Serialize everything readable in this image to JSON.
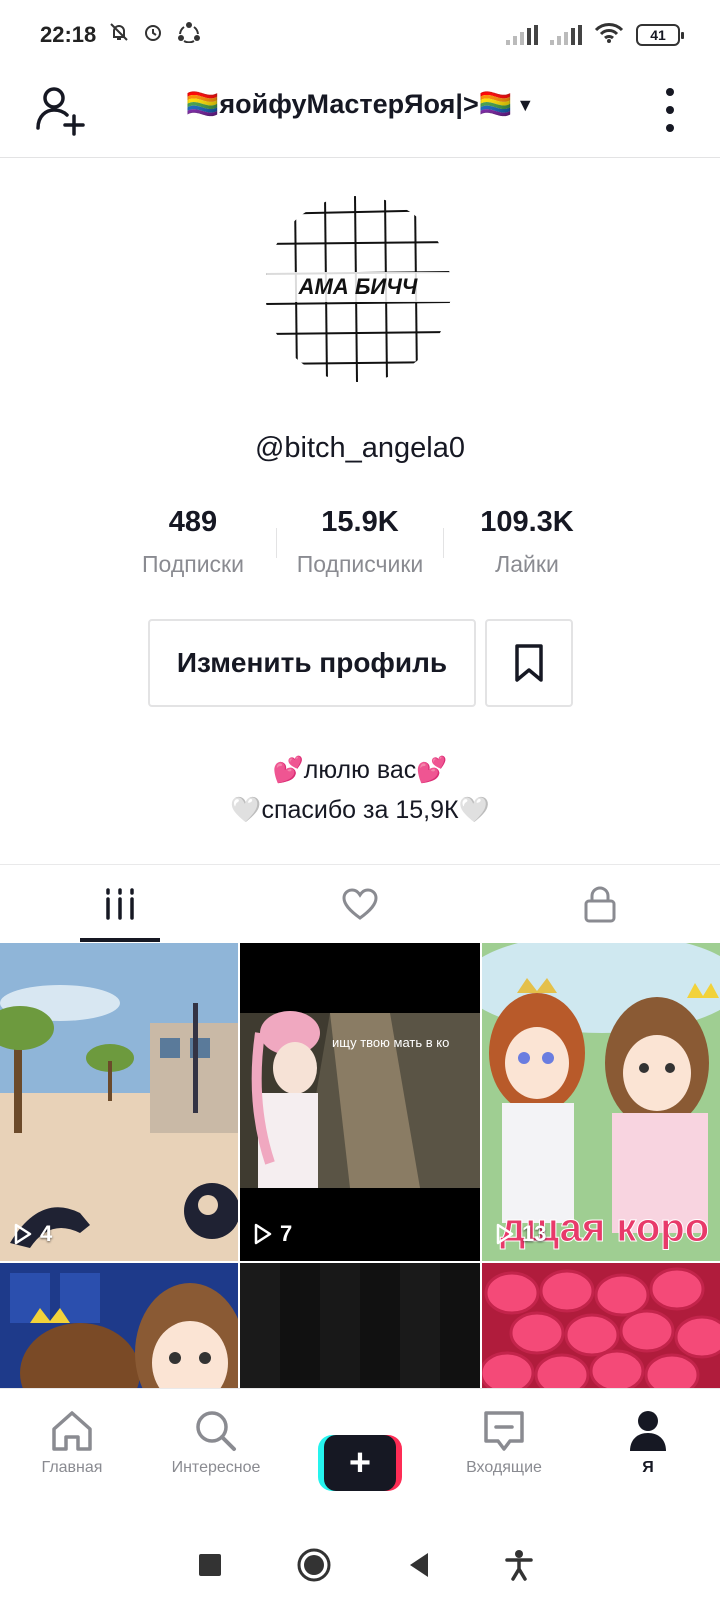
{
  "status_bar": {
    "time": "22:18",
    "battery": "41",
    "icons": [
      "mute-bell-icon",
      "alarm-icon",
      "sync-icon",
      "signal-icon",
      "signal-icon",
      "wifi-icon",
      "battery-icon"
    ]
  },
  "header": {
    "title": "🏳️‍🌈яойфуМастерЯоя|>🏳️‍🌈",
    "dropdown_icon": "caret-down-icon",
    "left_icon": "add-user-icon",
    "right_icon": "more-vertical-icon"
  },
  "profile": {
    "avatar_text": "АМА БИЧЧ",
    "username": "@bitch_angela0",
    "stats": [
      {
        "value": "489",
        "label": "Подписки"
      },
      {
        "value": "15.9K",
        "label": "Подписчики"
      },
      {
        "value": "109.3K",
        "label": "Лайки"
      }
    ],
    "edit_button": "Изменить профиль",
    "bookmark_icon": "bookmark-icon",
    "bio_line1": "💕люлю вас💕",
    "bio_line2": "🤍спасибо за 15,9К🤍"
  },
  "tabs": [
    {
      "icon": "videos-grid-icon",
      "active": true
    },
    {
      "icon": "heart-icon",
      "active": false
    },
    {
      "icon": "lock-icon",
      "active": false
    }
  ],
  "videos": [
    {
      "views": "4"
    },
    {
      "views": "7",
      "caption": "ищу твою мать в ко"
    },
    {
      "views": "13",
      "overlay_text": "дщая коро"
    },
    {
      "views": ""
    },
    {
      "views": ""
    },
    {
      "views": ""
    }
  ],
  "bottom_nav": {
    "home": "Главная",
    "discover": "Интересное",
    "create": "+",
    "inbox": "Входящие",
    "me": "Я"
  },
  "colors": {
    "accent_red": "#fe2c55",
    "accent_cyan": "#25f4ee",
    "text_primary": "#161823",
    "text_secondary": "#8a8b91"
  }
}
